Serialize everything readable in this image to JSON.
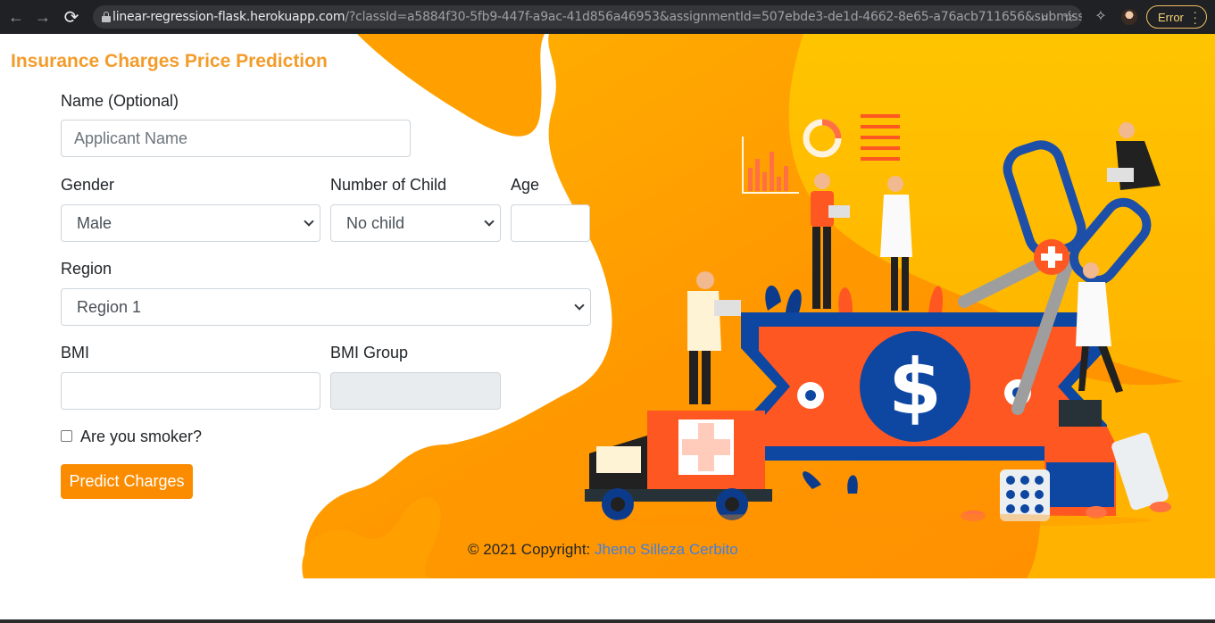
{
  "browser": {
    "url_host": "linear-regression-flask.herokuapp.com",
    "url_rest": "/?classId=a5884f30-5fb9-447f-a9ac-41d856a46953&assignmentId=507ebde3-de1d-4662-8e65-a76acb711656&submissio...",
    "error_label": "Error",
    "nav": {
      "back": "←",
      "forward": "→",
      "reload": "⟳"
    }
  },
  "page": {
    "title": "Insurance Charges Price Prediction"
  },
  "form": {
    "name_label": "Name (Optional)",
    "name_placeholder": "Applicant Name",
    "name_value": "",
    "gender_label": "Gender",
    "gender_value": "Male",
    "children_label": "Number of Child",
    "children_value": "No child",
    "age_label": "Age",
    "age_value": "",
    "region_label": "Region",
    "region_value": "Region 1",
    "bmi_label": "BMI",
    "bmi_value": "",
    "bmi_group_label": "BMI Group",
    "bmi_group_value": "",
    "smoker_label": "Are you smoker?",
    "smoker_checked": false,
    "submit_label": "Predict Charges"
  },
  "footer": {
    "copyright_prefix": "© 2021 Copyright: ",
    "author": "Jheno Silleza Cerbito"
  },
  "colors": {
    "accent": "#fb8c00",
    "title": "#f39c2b",
    "link": "#3f7fe0",
    "art_orange": "#ff9800",
    "art_yellow": "#ffc107",
    "art_blue": "#0d47a1"
  }
}
